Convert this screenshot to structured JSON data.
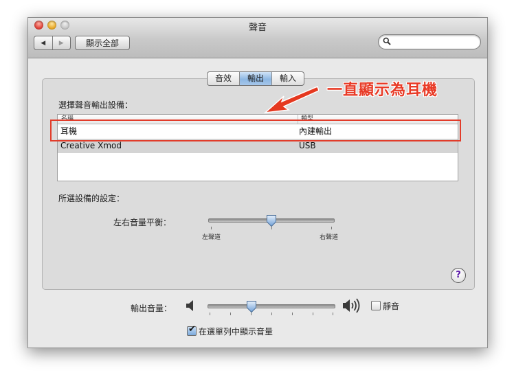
{
  "window": {
    "title": "聲音"
  },
  "toolbar": {
    "back": "◀",
    "forward": "▶",
    "show_all": "顯示全部",
    "search_placeholder": ""
  },
  "tabs": [
    {
      "label": "音效",
      "active": false
    },
    {
      "label": "輸出",
      "active": true
    },
    {
      "label": "輸入",
      "active": false
    }
  ],
  "output": {
    "select_label": "選擇聲音輸出設備：",
    "columns": [
      "名稱",
      "類型"
    ],
    "devices": [
      {
        "name": "耳機",
        "type": "內建輸出"
      },
      {
        "name": "Creative Xmod",
        "type": "USB"
      }
    ],
    "settings_label": "所選設備的設定：",
    "balance": {
      "label": "左右音量平衡：",
      "left": "左聲道",
      "right": "右聲道",
      "value": 0.5
    }
  },
  "help": "?",
  "volume": {
    "label": "輸出音量：",
    "value": 0.33,
    "mute_label": "靜音",
    "mute_checked": false
  },
  "menubar_volume": {
    "label": "在選單列中顯示音量",
    "checked": true
  },
  "annotation": {
    "text": "一直顯示為耳機",
    "color": "#e83a26"
  }
}
